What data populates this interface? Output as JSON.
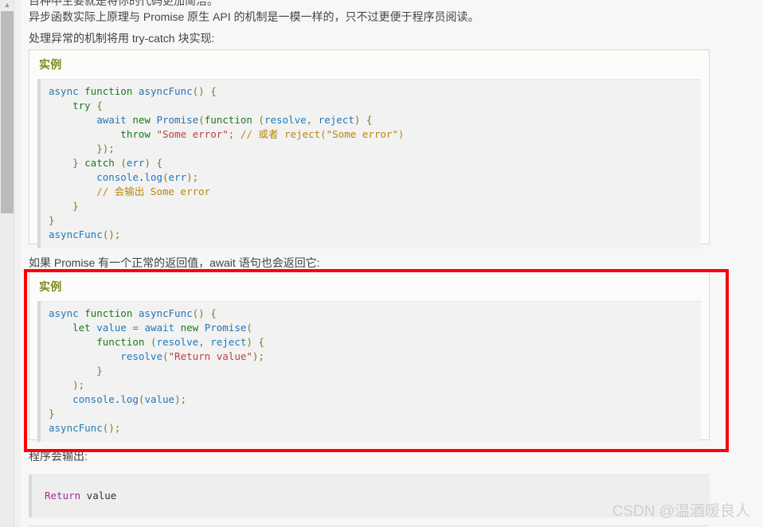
{
  "window": {
    "background_color": "#ececec",
    "page_background_color": "#f7f7f7",
    "scroll_up_arrow": "▲"
  },
  "annotation": {
    "highlight_color": "#fb0007",
    "shape": "rectangle"
  },
  "article": {
    "clipped_top_line": "百种中主要就是将你的代码更加简洁。",
    "paragraphs": [
      "异步函数实际上原理与 Promise 原生 API 的机制是一模一样的，只不过更便于程序员阅读。",
      "处理异常的机制将用 try-catch 块实现:",
      "如果 Promise 有一个正常的返回值，await 语句也会返回它:",
      "程序会输出:"
    ]
  },
  "examples": [
    {
      "title": "实例",
      "code_lines": [
        [
          {
            "t": "async ",
            "c": "bi"
          },
          {
            "t": "function ",
            "c": "kw"
          },
          {
            "t": "asyncFunc",
            "c": "fn"
          },
          {
            "t": "() {",
            "c": "pun"
          }
        ],
        [
          {
            "t": "    try ",
            "c": "kw"
          },
          {
            "t": "{",
            "c": "pun"
          }
        ],
        [
          {
            "t": "        await ",
            "c": "bi"
          },
          {
            "t": "new ",
            "c": "kw"
          },
          {
            "t": "Promise",
            "c": "fn"
          },
          {
            "t": "(",
            "c": "pun"
          },
          {
            "t": "function ",
            "c": "kw"
          },
          {
            "t": "(",
            "c": "pun"
          },
          {
            "t": "resolve",
            "c": "bi"
          },
          {
            "t": ", ",
            "c": "pun"
          },
          {
            "t": "reject",
            "c": "bi"
          },
          {
            "t": ") {",
            "c": "pun"
          }
        ],
        [
          {
            "t": "            throw ",
            "c": "kw"
          },
          {
            "t": "\"Some error\"",
            "c": "str"
          },
          {
            "t": ";",
            "c": "pun"
          },
          {
            "t": " // 或者 reject(\"Some error\")",
            "c": "com"
          }
        ],
        [
          {
            "t": "        });",
            "c": "pun"
          }
        ],
        [
          {
            "t": "    } ",
            "c": "pun"
          },
          {
            "t": "catch ",
            "c": "kw"
          },
          {
            "t": "(",
            "c": "pun"
          },
          {
            "t": "err",
            "c": "bi"
          },
          {
            "t": ") {",
            "c": "pun"
          }
        ],
        [
          {
            "t": "        console",
            "c": "bi"
          },
          {
            "t": ".",
            "c": "pl"
          },
          {
            "t": "log",
            "c": "prop"
          },
          {
            "t": "(",
            "c": "pun"
          },
          {
            "t": "err",
            "c": "bi"
          },
          {
            "t": ");",
            "c": "pun"
          }
        ],
        [
          {
            "t": "        // 会输出 Some error",
            "c": "com"
          }
        ],
        [
          {
            "t": "    }",
            "c": "pun"
          }
        ],
        [
          {
            "t": "}",
            "c": "pun"
          }
        ],
        [
          {
            "t": "asyncFunc",
            "c": "bi"
          },
          {
            "t": "();",
            "c": "pun"
          }
        ]
      ]
    },
    {
      "title": "实例",
      "code_lines": [
        [
          {
            "t": "async ",
            "c": "bi"
          },
          {
            "t": "function ",
            "c": "kw"
          },
          {
            "t": "asyncFunc",
            "c": "fn"
          },
          {
            "t": "() {",
            "c": "pun"
          }
        ],
        [
          {
            "t": "    let ",
            "c": "kw"
          },
          {
            "t": "value ",
            "c": "bi"
          },
          {
            "t": "= ",
            "c": "pun"
          },
          {
            "t": "await ",
            "c": "bi"
          },
          {
            "t": "new ",
            "c": "kw"
          },
          {
            "t": "Promise",
            "c": "fn"
          },
          {
            "t": "(",
            "c": "pun"
          }
        ],
        [
          {
            "t": "        function ",
            "c": "kw"
          },
          {
            "t": "(",
            "c": "pun"
          },
          {
            "t": "resolve",
            "c": "bi"
          },
          {
            "t": ", ",
            "c": "pun"
          },
          {
            "t": "reject",
            "c": "bi"
          },
          {
            "t": ") {",
            "c": "pun"
          }
        ],
        [
          {
            "t": "            resolve",
            "c": "bi"
          },
          {
            "t": "(",
            "c": "pun"
          },
          {
            "t": "\"Return value\"",
            "c": "str"
          },
          {
            "t": ");",
            "c": "pun"
          }
        ],
        [
          {
            "t": "        }",
            "c": "pun"
          }
        ],
        [
          {
            "t": "    );",
            "c": "pun"
          }
        ],
        [
          {
            "t": "    console",
            "c": "bi"
          },
          {
            "t": ".",
            "c": "pl"
          },
          {
            "t": "log",
            "c": "prop"
          },
          {
            "t": "(",
            "c": "pun"
          },
          {
            "t": "value",
            "c": "bi"
          },
          {
            "t": ");",
            "c": "pun"
          }
        ],
        [
          {
            "t": "}",
            "c": "pun"
          }
        ],
        [
          {
            "t": "asyncFunc",
            "c": "bi"
          },
          {
            "t": "();",
            "c": "pun"
          }
        ]
      ]
    }
  ],
  "output": {
    "lines": [
      [
        {
          "t": "Return",
          "c": "out-kw"
        },
        {
          "t": " value",
          "c": "pl"
        }
      ]
    ]
  },
  "watermark": {
    "text": "CSDN @温酒暖良人"
  }
}
